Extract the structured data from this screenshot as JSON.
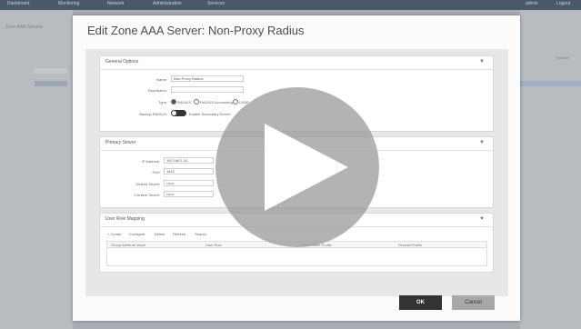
{
  "app": {
    "topbar_items": [
      "Dashboard",
      "Monitoring",
      "Network",
      "Administration",
      "Services",
      "",
      "admin",
      "Logout"
    ],
    "left_text": "Zone AAA Servers",
    "right_text": "Refresh"
  },
  "modal": {
    "title": "Edit Zone AAA Server: Non-Proxy Radius",
    "general": {
      "header": "General Options",
      "name_label": "Name:",
      "name_value": "Non-Proxy Radius",
      "description_label": "Description:",
      "description_value": "",
      "type_label": "Type:",
      "type_options": [
        "RADIUS",
        "RADIUS Accounting",
        "LDAP"
      ],
      "backup_label": "Backup RADIUS:",
      "backup_text": "Enable Secondary Server"
    },
    "primary": {
      "header": "Primary Server",
      "ip_label": "IP Address:",
      "ip_value": "192.168.1.10",
      "port_label": "Port:",
      "port_value": "1812",
      "secret_label": "Shared Secret:",
      "secret_value": "••••••",
      "confirm_label": "Confirm Secret:",
      "confirm_value": "••••••"
    },
    "mapping": {
      "header": "User Role Mapping",
      "buttons": [
        "+ Create",
        "Configure",
        "Delete",
        "Refresh",
        "Search"
      ],
      "columns": [
        "Group Attribute Value",
        "User Role",
        "User Traffic Profile",
        "Firewall Profile"
      ]
    },
    "ok_label": "OK",
    "cancel_label": "Cancel"
  },
  "colors": {
    "topbar": "#4a5868",
    "ok_button": "#333333",
    "cancel_button": "#a8a8a8",
    "play_overlay": "#969696"
  },
  "icons": [
    "chevron-down-icon",
    "play-icon",
    "toggle-switch"
  ]
}
